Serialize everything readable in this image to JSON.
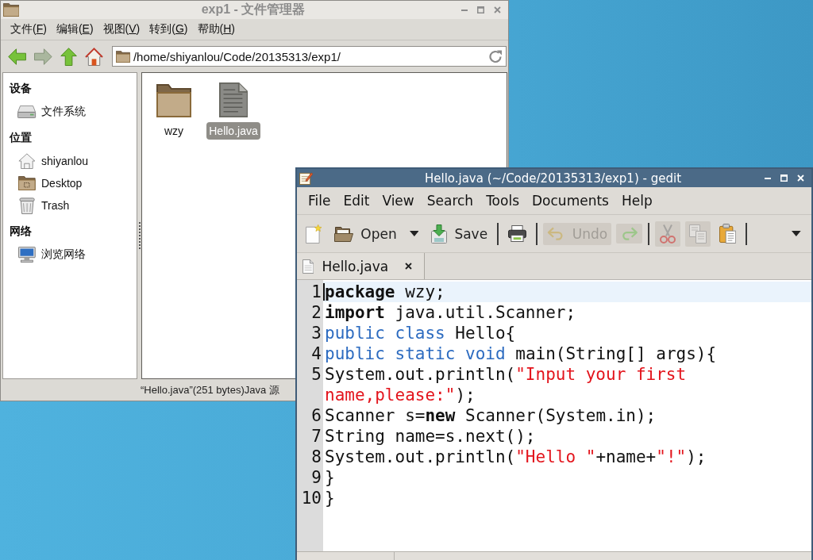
{
  "file_manager": {
    "active": false,
    "title": "exp1 - 文件管理器",
    "menu": [
      {
        "text": "文件(",
        "key": "F",
        "tail": ")"
      },
      {
        "text": "编辑(",
        "key": "E",
        "tail": ")"
      },
      {
        "text": "视图(",
        "key": "V",
        "tail": ")"
      },
      {
        "text": "转到(",
        "key": "G",
        "tail": ")"
      },
      {
        "text": "帮助(",
        "key": "H",
        "tail": ")"
      }
    ],
    "toolbar": [
      {
        "kind": "back",
        "disabled": false
      },
      {
        "kind": "forward",
        "disabled": true
      },
      {
        "kind": "up",
        "disabled": false
      },
      {
        "kind": "home",
        "disabled": false
      }
    ],
    "location": {
      "value": "/home/shiyanlou/Code/20135313/exp1/"
    },
    "sidebar": [
      {
        "heading": "设备",
        "items": [
          {
            "kind": "drive",
            "label": "文件系统",
            "selected": false
          }
        ]
      },
      {
        "heading": "位置",
        "items": [
          {
            "kind": "home",
            "label": "shiyanlou",
            "selected": false
          },
          {
            "kind": "desktop",
            "label": "Desktop",
            "selected": false
          },
          {
            "kind": "trash",
            "label": "Trash",
            "selected": false
          }
        ]
      },
      {
        "heading": "网络",
        "items": [
          {
            "kind": "network",
            "label": "浏览网络",
            "selected": false
          }
        ]
      }
    ],
    "files": [
      {
        "kind": "folder",
        "name": "wzy",
        "selected": false
      },
      {
        "kind": "text",
        "name": "Hello.java",
        "selected": true
      }
    ],
    "status_bar": "“Hello.java”(251 bytes)Java 源"
  },
  "gedit": {
    "active": true,
    "title": "Hello.java (~/Code/20135313/exp1) - gedit",
    "menu": [
      "File",
      "Edit",
      "View",
      "Search",
      "Tools",
      "Documents",
      "Help"
    ],
    "toolbar": [
      [
        {
          "kind": "new",
          "disabled": false
        },
        {
          "kind": "open",
          "label": "Open",
          "disabled": false
        },
        {
          "kind": "open-menu",
          "disabled": false
        },
        {
          "kind": "save",
          "label": "Save",
          "disabled": false
        }
      ],
      [
        {
          "kind": "print",
          "disabled": false
        }
      ],
      [
        {
          "kind": "undo",
          "label": "Undo",
          "disabled": true
        },
        {
          "kind": "redo",
          "disabled": true
        }
      ],
      [
        {
          "kind": "cut",
          "disabled": true
        },
        {
          "kind": "copy",
          "disabled": true
        },
        {
          "kind": "paste",
          "disabled": false
        }
      ]
    ],
    "toolbar_overflow": true,
    "tabs": [
      {
        "label": "Hello.java",
        "selected": true
      }
    ],
    "editor": {
      "lines": [
        {
          "number": "1",
          "current": true,
          "tokens": [
            {
              "kind": "keyword",
              "text": "package"
            },
            {
              "kind": "plain",
              "text": " wzy;"
            }
          ]
        },
        {
          "number": "2",
          "current": false,
          "tokens": [
            {
              "kind": "keyword",
              "text": "import"
            },
            {
              "kind": "plain",
              "text": " java.util.Scanner;"
            }
          ]
        },
        {
          "number": "3",
          "current": false,
          "tokens": [
            {
              "kind": "type",
              "text": "public"
            },
            {
              "kind": "type",
              "text": " class"
            },
            {
              "kind": "plain",
              "text": " Hello{"
            }
          ]
        },
        {
          "number": "4",
          "current": false,
          "tokens": [
            {
              "kind": "type",
              "text": "public"
            },
            {
              "kind": "type",
              "text": " static"
            },
            {
              "kind": "type",
              "text": " void"
            },
            {
              "kind": "plain",
              "text": " main(String[] args){"
            }
          ]
        },
        {
          "number": "5",
          "current": false,
          "tokens": [
            {
              "kind": "plain",
              "text": "System.out.println("
            },
            {
              "kind": "string",
              "text": "\"Input your first name,please:\""
            },
            {
              "kind": "plain",
              "text": ");"
            }
          ]
        },
        {
          "number": "6",
          "current": false,
          "tokens": [
            {
              "kind": "plain",
              "text": "Scanner s="
            },
            {
              "kind": "keyword",
              "text": "new"
            },
            {
              "kind": "plain",
              "text": " Scanner(System.in);"
            }
          ]
        },
        {
          "number": "7",
          "current": false,
          "tokens": [
            {
              "kind": "plain",
              "text": "String name=s.next();"
            }
          ]
        },
        {
          "number": "8",
          "current": false,
          "tokens": [
            {
              "kind": "plain",
              "text": "System.out.println("
            },
            {
              "kind": "string",
              "text": "\"Hello \""
            },
            {
              "kind": "plain",
              "text": "+name+"
            },
            {
              "kind": "string",
              "text": "\"!\""
            },
            {
              "kind": "plain",
              "text": ");"
            }
          ]
        },
        {
          "number": "9",
          "current": false,
          "tokens": [
            {
              "kind": "plain",
              "text": "}"
            }
          ]
        },
        {
          "number": "10",
          "current": false,
          "tokens": [
            {
              "kind": "plain",
              "text": "}"
            }
          ]
        }
      ]
    }
  }
}
